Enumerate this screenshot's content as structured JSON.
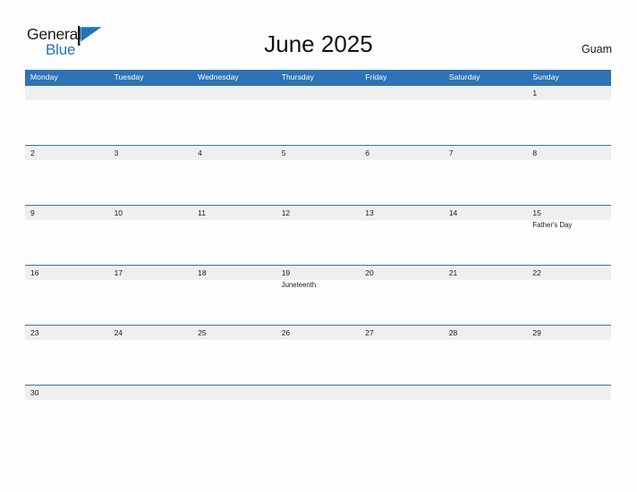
{
  "brand": {
    "name_part1": "General",
    "name_part2": "Blue",
    "flag_icon": "flag-icon",
    "dark_color": "#1b1b1b",
    "blue_color": "#1d74bd"
  },
  "header": {
    "title": "June 2025",
    "location": "Guam"
  },
  "theme": {
    "header_blue": "#2e74b4",
    "number_band_gray": "#efefef",
    "page_background": "#fdfdfd",
    "text_color": "#1b1b1b"
  },
  "calendar": {
    "month": "June",
    "year": "2025",
    "weekday_headers": [
      "Monday",
      "Tuesday",
      "Wednesday",
      "Thursday",
      "Friday",
      "Saturday",
      "Sunday"
    ],
    "weeks": [
      {
        "size": "tall",
        "days": [
          {
            "number": "",
            "event": ""
          },
          {
            "number": "",
            "event": ""
          },
          {
            "number": "",
            "event": ""
          },
          {
            "number": "",
            "event": ""
          },
          {
            "number": "",
            "event": ""
          },
          {
            "number": "",
            "event": ""
          },
          {
            "number": "1",
            "event": ""
          }
        ]
      },
      {
        "size": "tall",
        "days": [
          {
            "number": "2",
            "event": ""
          },
          {
            "number": "3",
            "event": ""
          },
          {
            "number": "4",
            "event": ""
          },
          {
            "number": "5",
            "event": ""
          },
          {
            "number": "6",
            "event": ""
          },
          {
            "number": "7",
            "event": ""
          },
          {
            "number": "8",
            "event": ""
          }
        ]
      },
      {
        "size": "tall",
        "days": [
          {
            "number": "9",
            "event": ""
          },
          {
            "number": "10",
            "event": ""
          },
          {
            "number": "11",
            "event": ""
          },
          {
            "number": "12",
            "event": ""
          },
          {
            "number": "13",
            "event": ""
          },
          {
            "number": "14",
            "event": ""
          },
          {
            "number": "15",
            "event": "Father's Day"
          }
        ]
      },
      {
        "size": "tall",
        "days": [
          {
            "number": "16",
            "event": ""
          },
          {
            "number": "17",
            "event": ""
          },
          {
            "number": "18",
            "event": ""
          },
          {
            "number": "19",
            "event": "Juneteenth"
          },
          {
            "number": "20",
            "event": ""
          },
          {
            "number": "21",
            "event": ""
          },
          {
            "number": "22",
            "event": ""
          }
        ]
      },
      {
        "size": "tall",
        "days": [
          {
            "number": "23",
            "event": ""
          },
          {
            "number": "24",
            "event": ""
          },
          {
            "number": "25",
            "event": ""
          },
          {
            "number": "26",
            "event": ""
          },
          {
            "number": "27",
            "event": ""
          },
          {
            "number": "28",
            "event": ""
          },
          {
            "number": "29",
            "event": ""
          }
        ]
      },
      {
        "size": "short",
        "days": [
          {
            "number": "30",
            "event": ""
          },
          {
            "number": "",
            "event": ""
          },
          {
            "number": "",
            "event": ""
          },
          {
            "number": "",
            "event": ""
          },
          {
            "number": "",
            "event": ""
          },
          {
            "number": "",
            "event": ""
          },
          {
            "number": "",
            "event": ""
          }
        ]
      }
    ]
  }
}
